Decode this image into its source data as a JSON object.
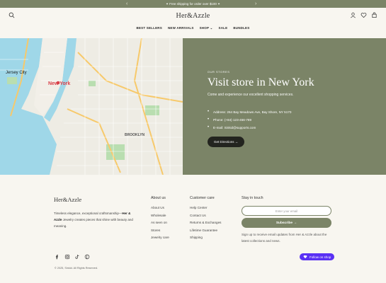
{
  "announcement": {
    "text": "✦ Free shipping for order over $100 ✦",
    "prev": "‹",
    "next": "›"
  },
  "header": {
    "logo": "Her&Azzle"
  },
  "nav": {
    "items": [
      "BEST SELLERS",
      "NEW ARRIVALS",
      "SHOP ⌄",
      "SALE",
      "BUNDLES"
    ]
  },
  "store": {
    "eyebrow": "OUR STORES",
    "title": "Visit store in New York",
    "subtitle": "Come and experience our excellent shopping services.",
    "address": "Address: 264 Bay Meadows Ave, Bay Shore, NY 5170",
    "phone": "Phone: (+84) 123-456-789",
    "email": "E-mail: Sinkid@supports.com",
    "button": "Get Directions →"
  },
  "map": {
    "labels": {
      "jersey": "Jersey City",
      "ny": "New York",
      "brooklyn": "BROOKLYN"
    }
  },
  "footer": {
    "logo": "Her&Azzle",
    "desc_pre": "Timeless elegance, exceptional craftsmanship—",
    "desc_brand": "Her & Azzle",
    "desc_post": " Jewelry creates pieces that shine with beauty and meaning.",
    "about": {
      "title": "About us",
      "links": [
        "About Us",
        "Wholesale",
        "As seen on",
        "Stores",
        "Jewelry care"
      ]
    },
    "care": {
      "title": "Customer care",
      "links": [
        "Help Center",
        "Contact Us",
        "Returns & Exchanges",
        "Lifetime Guarantee",
        "Shipping"
      ]
    },
    "touch": {
      "title": "Stay in touch",
      "email_placeholder": "Enter your email",
      "subscribe": "Subscribe →",
      "note": "Sign up to receive email updates from Her & Azzle about the latest collections and news."
    },
    "copyright": "© 2025, Sinkid. All Rights Reserved.",
    "shop_button": "Follow on shop"
  },
  "colors": {
    "accent": "#7b8467",
    "dark": "#23241f",
    "shop": "#5a31f4"
  }
}
